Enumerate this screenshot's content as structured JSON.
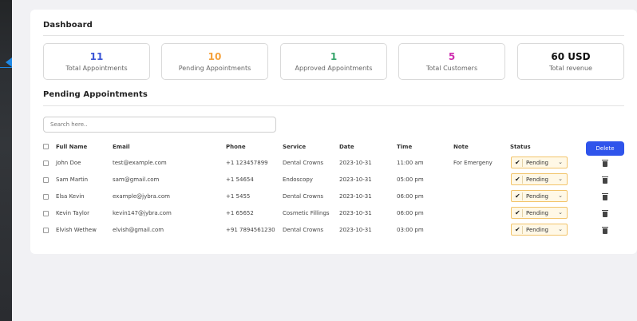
{
  "dashboard": {
    "title": "Dashboard"
  },
  "stats": [
    {
      "value": "11",
      "label": "Total Appointments",
      "color": "#3b55d6"
    },
    {
      "value": "10",
      "label": "Pending Appointments",
      "color": "#f5a13b"
    },
    {
      "value": "1",
      "label": "Approved Appointments",
      "color": "#37a56c"
    },
    {
      "value": "5",
      "label": "Total Customers",
      "color": "#cf2fb0"
    },
    {
      "value": "60 USD",
      "label": "Total revenue",
      "color": "#111111"
    }
  ],
  "pending": {
    "title": "Pending Appointments",
    "search_placeholder": "Search here..",
    "delete_label": "Delete",
    "columns": [
      "Full Name",
      "Email",
      "Phone",
      "Service",
      "Date",
      "Time",
      "Note",
      "Status"
    ],
    "rows": [
      {
        "name": "John Doe",
        "email": "test@example.com",
        "phone": "+1 123457899",
        "service": "Dental Crowns",
        "date": "2023-10-31",
        "time": "11:00 am",
        "note": "For Emergeny",
        "status": "Pending"
      },
      {
        "name": "Sam Martin",
        "email": "sam@gmail.com",
        "phone": "+1 54654",
        "service": "Endoscopy",
        "date": "2023-10-31",
        "time": "05:00 pm",
        "note": "",
        "status": "Pending"
      },
      {
        "name": "Elsa Kevin",
        "email": "example@jybra.com",
        "phone": "+1 5455",
        "service": "Dental Crowns",
        "date": "2023-10-31",
        "time": "06:00 pm",
        "note": "",
        "status": "Pending"
      },
      {
        "name": "Kevin Taylor",
        "email": "kevin147@jybra.com",
        "phone": "+1 65652",
        "service": "Cosmetic Fillings",
        "date": "2023-10-31",
        "time": "06:00 pm",
        "note": "",
        "status": "Pending"
      },
      {
        "name": "Elvish Wethew",
        "email": "elvish@gmail.com",
        "phone": "+91 7894561230",
        "service": "Dental Crowns",
        "date": "2023-10-31",
        "time": "03:00 pm",
        "note": "",
        "status": "Pending"
      }
    ]
  }
}
